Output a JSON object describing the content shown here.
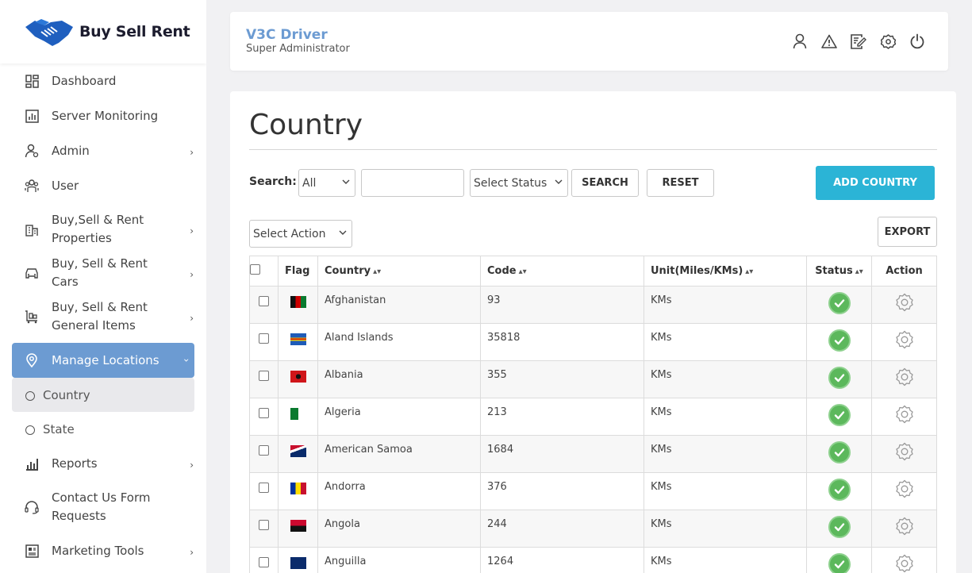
{
  "brand": {
    "logo_text": "Buy Sell Rent"
  },
  "sidebar": {
    "items": [
      {
        "label": "Dashboard",
        "icon": "dashboard-icon"
      },
      {
        "label": "Server Monitoring",
        "icon": "monitor-chart-icon"
      },
      {
        "label": "Admin",
        "icon": "admin-user-icon",
        "has_children": true
      },
      {
        "label": "User",
        "icon": "users-icon"
      },
      {
        "label": "Buy,Sell & Rent Properties",
        "icon": "building-icon",
        "has_children": true
      },
      {
        "label": "Buy, Sell & Rent Cars",
        "icon": "car-icon",
        "has_children": true
      },
      {
        "label": "Buy, Sell & Rent General Items",
        "icon": "cart-icon",
        "has_children": true
      },
      {
        "label": "Manage Locations",
        "icon": "location-pin-icon",
        "has_children": true,
        "active": true
      },
      {
        "label": "Reports",
        "icon": "bar-chart-icon",
        "has_children": true
      },
      {
        "label": "Contact Us Form Requests",
        "icon": "headset-icon"
      },
      {
        "label": "Marketing Tools",
        "icon": "newspaper-icon",
        "has_children": true
      }
    ],
    "sub_items": [
      {
        "label": "Country",
        "selected": true
      },
      {
        "label": "State",
        "selected": false
      }
    ]
  },
  "header": {
    "user_name": "V3C Driver",
    "user_role": "Super Administrator",
    "icons": [
      "profile-icon",
      "alert-icon",
      "edit-note-icon",
      "settings-icon",
      "power-icon"
    ]
  },
  "page": {
    "title": "Country",
    "search_label": "Search:",
    "search_field_value": "All",
    "search_input_value": "",
    "status_select_value": "Select Status",
    "search_button": "SEARCH",
    "reset_button": "RESET",
    "add_button": "ADD COUNTRY",
    "action_select_value": "Select Action",
    "export_button": "EXPORT"
  },
  "table": {
    "columns": [
      "Flag",
      "Country",
      "Code",
      "Unit(Miles/KMs)",
      "Status",
      "Action"
    ],
    "rows": [
      {
        "country": "Afghanistan",
        "code": "93",
        "unit": "KMs",
        "status": "active"
      },
      {
        "country": "Aland Islands",
        "code": "35818",
        "unit": "KMs",
        "status": "active"
      },
      {
        "country": "Albania",
        "code": "355",
        "unit": "KMs",
        "status": "active"
      },
      {
        "country": "Algeria",
        "code": "213",
        "unit": "KMs",
        "status": "active"
      },
      {
        "country": "American Samoa",
        "code": "1684",
        "unit": "KMs",
        "status": "active"
      },
      {
        "country": "Andorra",
        "code": "376",
        "unit": "KMs",
        "status": "active"
      },
      {
        "country": "Angola",
        "code": "244",
        "unit": "KMs",
        "status": "active"
      },
      {
        "country": "Anguilla",
        "code": "1264",
        "unit": "KMs",
        "status": "active"
      }
    ]
  },
  "colors": {
    "accent": "#6c9bd2",
    "primary_button": "#2bb4d6",
    "status_active": "#5cb85c"
  }
}
